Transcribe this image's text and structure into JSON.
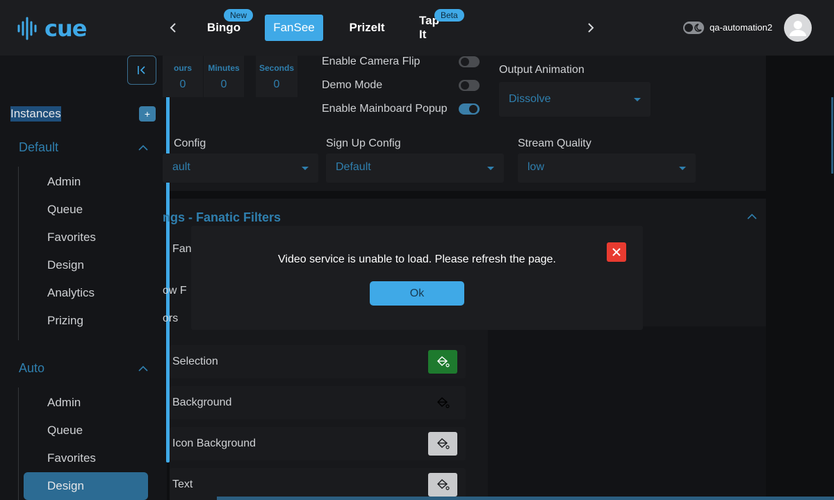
{
  "header": {
    "logo_text": "cue",
    "tabs": [
      {
        "label": "Bingo",
        "badge": "New"
      },
      {
        "label": "FanSee",
        "badge": ""
      },
      {
        "label": "PrizeIt",
        "badge": ""
      },
      {
        "label": "Tap It",
        "badge": "Beta"
      }
    ],
    "active_tab": "FanSee",
    "username": "qa-automation2",
    "accent_color": "#3fa9e7"
  },
  "sidebar": {
    "section_label": "Instances",
    "add_label": "+",
    "groups": [
      {
        "title": "Default",
        "items": [
          "Admin",
          "Queue",
          "Favorites",
          "Design",
          "Analytics",
          "Prizing"
        ]
      },
      {
        "title": "Auto",
        "items": [
          "Admin",
          "Queue",
          "Favorites",
          "Design"
        ]
      }
    ],
    "active_item": "Design"
  },
  "main": {
    "timer": [
      {
        "label": "ours",
        "value": "0"
      },
      {
        "label": "Minutes",
        "value": "0"
      },
      {
        "label": "Seconds",
        "value": "0"
      }
    ],
    "toggles": [
      {
        "label": "Enable Camera Flip",
        "on": false
      },
      {
        "label": "Demo Mode",
        "on": false
      },
      {
        "label": "Enable Mainboard Popup",
        "on": true
      }
    ],
    "output_animation": {
      "label": "Output Animation",
      "value": "Dissolve"
    },
    "configs": [
      {
        "label": "Config",
        "value": "ault"
      },
      {
        "label": "Sign Up Config",
        "value": "Default"
      },
      {
        "label": "Stream Quality",
        "value": "low"
      }
    ],
    "section_title": "ngs - Fanatic Filters",
    "partial_rows": [
      "Fan",
      "ow F",
      "ors"
    ],
    "color_rows": [
      {
        "label": "Selection",
        "swatch": "#1e7a2e"
      },
      {
        "label": "Background",
        "swatch": "#1a1b1e"
      },
      {
        "label": "Icon Background",
        "swatch": "#c9cacc"
      },
      {
        "label": "Text",
        "swatch": "#c9cacc"
      }
    ]
  },
  "modal": {
    "message": "Video service is unable to load. Please refresh the page.",
    "ok_label": "Ok",
    "close_color": "#e83b30"
  }
}
